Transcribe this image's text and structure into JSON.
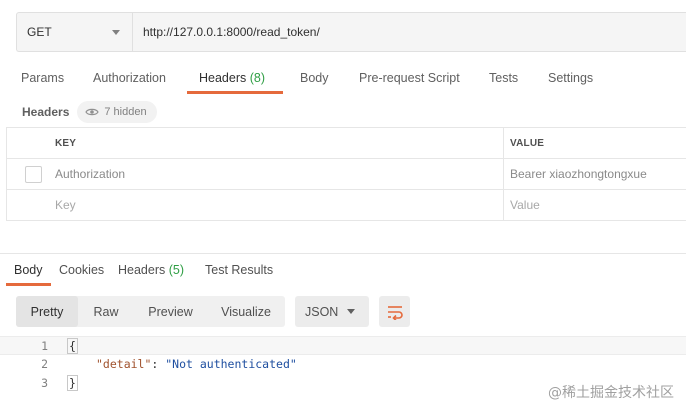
{
  "request": {
    "method": "GET",
    "url": "http://127.0.0.1:8000/read_token/"
  },
  "request_tabs": {
    "params": "Params",
    "authorization": "Authorization",
    "headers": "Headers",
    "headers_count": "(8)",
    "body": "Body",
    "prerequest": "Pre-request Script",
    "tests": "Tests",
    "settings": "Settings"
  },
  "headers_section": {
    "title": "Headers",
    "hidden_label": "7 hidden"
  },
  "headers_table": {
    "col_key": "KEY",
    "col_value": "VALUE",
    "rows": [
      {
        "key": "Authorization",
        "value": "Bearer xiaozhongtongxue"
      }
    ],
    "placeholder_key": "Key",
    "placeholder_value": "Value"
  },
  "response_tabs": {
    "body": "Body",
    "cookies": "Cookies",
    "headers": "Headers",
    "headers_count": "(5)",
    "test_results": "Test Results"
  },
  "response_view": {
    "pretty": "Pretty",
    "raw": "Raw",
    "preview": "Preview",
    "visualize": "Visualize",
    "format": "JSON"
  },
  "code": {
    "line_numbers": [
      "1",
      "2",
      "3"
    ],
    "open_brace": "{",
    "key": "\"detail\"",
    "colon": ": ",
    "value": "\"Not authenticated\"",
    "close_brace": "}"
  },
  "watermark": "@稀土掘金技术社区",
  "colors": {
    "accent": "#e56a3c",
    "count_green": "#2f9e44"
  }
}
